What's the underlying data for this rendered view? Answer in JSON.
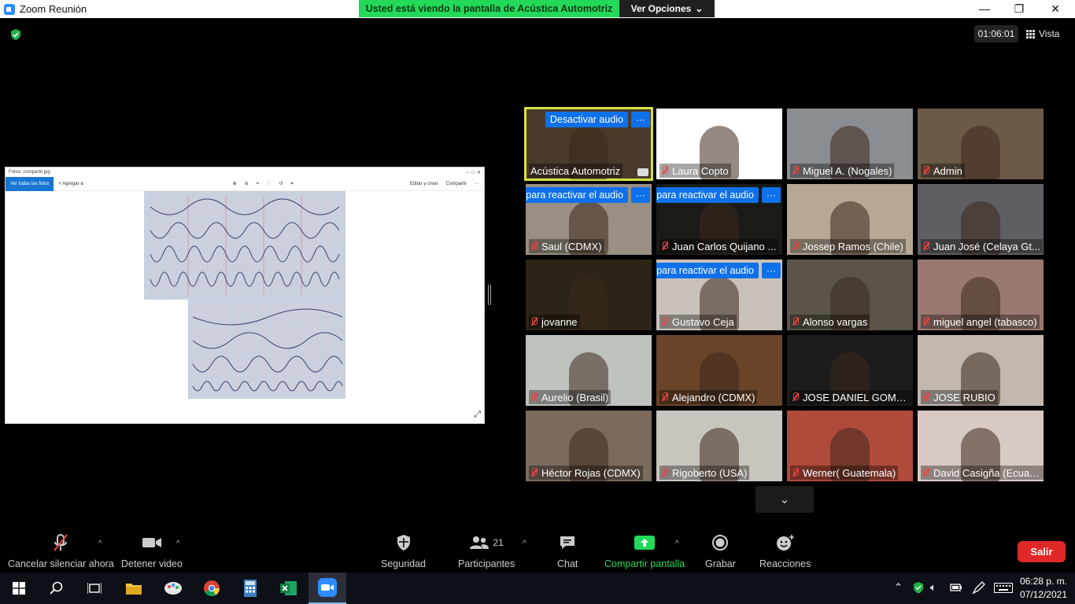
{
  "window": {
    "title": "Zoom Reunión",
    "share_banner": "Usted está viendo la pantalla de Acústica Automotriz",
    "view_options": "Ver Opciones",
    "timer": "01:06:01",
    "view_label": "Vista"
  },
  "shared_screen": {
    "app_title": "Fotos: compartir.jpg",
    "all_photos": "Ver todas las fotos",
    "add": "Agregar a",
    "edit": "Editar y crear",
    "share": "Compartir"
  },
  "participants": [
    {
      "name": "Acústica Automotriz",
      "muted": false,
      "bubble": "Desactivar audio",
      "bg": "#4a3a2c",
      "active": true
    },
    {
      "name": "Laura Copto",
      "muted": true,
      "bubble": "",
      "bg": "#ffffff"
    },
    {
      "name": "Miguel A. (Nogales)",
      "muted": true,
      "bubble": "",
      "bg": "#8a8d91"
    },
    {
      "name": "Admin",
      "muted": true,
      "bubble": "",
      "bg": "#6b5a48"
    },
    {
      "name": "Saul (CDMX)",
      "muted": true,
      "bubble": "r para reactivar el audio",
      "bg": "#9a8f82"
    },
    {
      "name": "Juan Carlos Quijano ...",
      "muted": true,
      "bubble": "r para reactivar el audio",
      "bg": "#1a1a16"
    },
    {
      "name": "Jossep Ramos (Chile)",
      "muted": true,
      "bubble": "",
      "bg": "#b6a894"
    },
    {
      "name": "Juan José (Celaya Gt...",
      "muted": true,
      "bubble": "",
      "bg": "#5e5e63"
    },
    {
      "name": "jovanne",
      "muted": true,
      "bubble": "",
      "bg": "#2c2416"
    },
    {
      "name": "Gustavo Ceja",
      "muted": true,
      "bubble": "r para reactivar el audio",
      "bg": "#c9c2ba"
    },
    {
      "name": "Alonso vargas",
      "muted": true,
      "bubble": "",
      "bg": "#5a5548"
    },
    {
      "name": "miguel angel (tabasco)",
      "muted": true,
      "bubble": "",
      "bg": "#9a7a70"
    },
    {
      "name": "Aurelio (Brasil)",
      "muted": true,
      "bubble": "",
      "bg": "#bfc3bd"
    },
    {
      "name": "Alejandro (CDMX)",
      "muted": true,
      "bubble": "",
      "bg": "#6a4428"
    },
    {
      "name": "JOSE DANIEL GOMEZ...",
      "muted": true,
      "bubble": "",
      "bg": "#1c1c1c"
    },
    {
      "name": "JOSE RUBIO",
      "muted": true,
      "bubble": "",
      "bg": "#c2b8b0"
    },
    {
      "name": "Héctor Rojas (CDMX)",
      "muted": true,
      "bubble": "",
      "bg": "#7a6b5c"
    },
    {
      "name": "Rigoberto (USA)",
      "muted": true,
      "bubble": "",
      "bg": "#c9c4bd"
    },
    {
      "name": "Werner( Guatemala)",
      "muted": true,
      "bubble": "",
      "bg": "#b04a3a"
    },
    {
      "name": "David Casigña (Ecuad...",
      "muted": true,
      "bubble": "",
      "bg": "#d9c9c4"
    }
  ],
  "toolbar": {
    "unmute": "Cancelar silenciar ahora",
    "stop_video": "Detener video",
    "security": "Seguridad",
    "participants": "Participantes",
    "participants_count": "21",
    "chat": "Chat",
    "share": "Compartir pantalla",
    "record": "Grabar",
    "reactions": "Reacciones",
    "leave": "Salir"
  },
  "taskbar": {
    "time": "06:28 p. m.",
    "date": "07/12/2021"
  },
  "colors": {
    "zoom_blue": "#0e71eb",
    "share_green": "#23D959",
    "leave_red": "#e02828",
    "active_speaker": "#d5e13f"
  }
}
